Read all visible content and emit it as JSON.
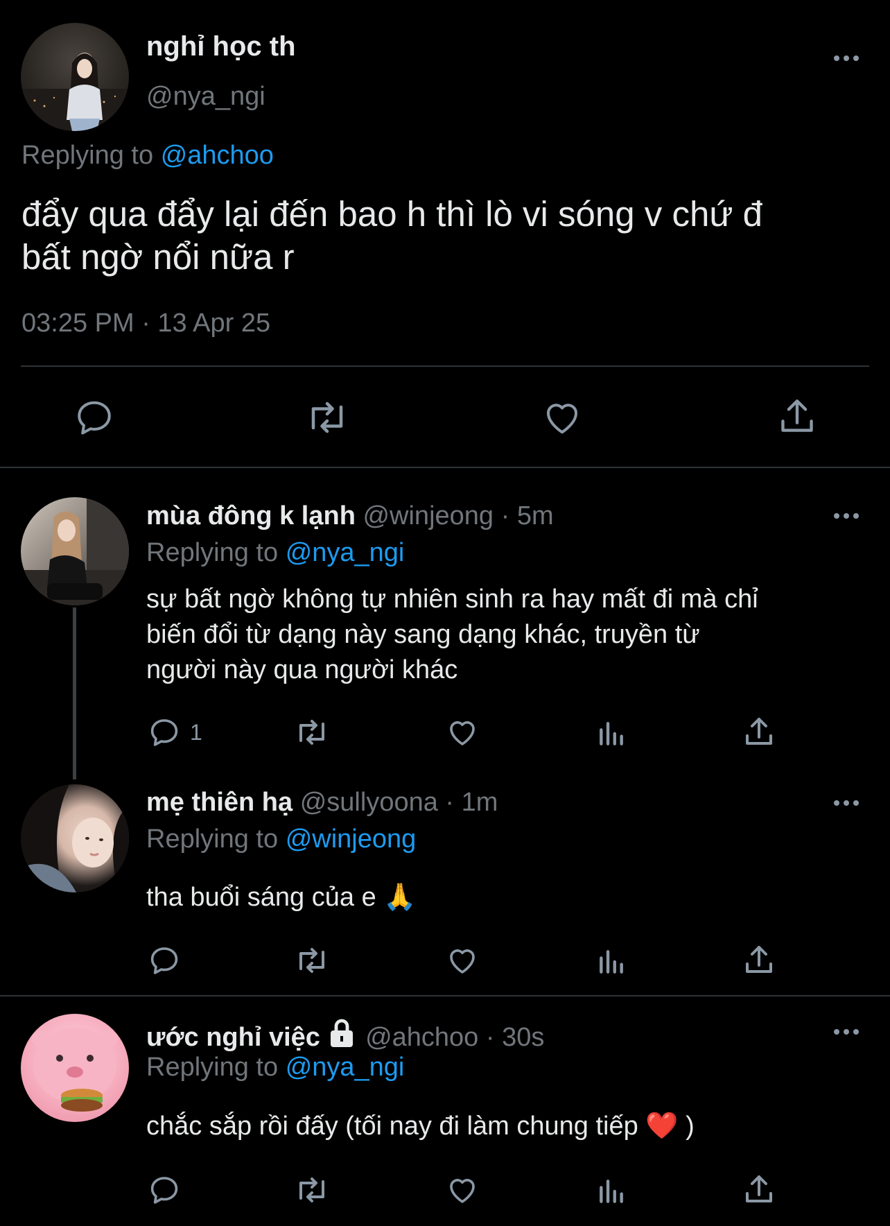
{
  "main_tweet": {
    "display_name": "nghỉ học th",
    "handle": "@nya_ngi",
    "replying_label": "Replying to",
    "replying_to": "@ahchoo",
    "text_line1": "đẩy qua đẩy lại đến bao h thì lò vi sóng v chứ đ",
    "text_line2": "bất ngờ nổi nữa r",
    "timestamp": "03:25 PM · 13 Apr 25"
  },
  "replies": [
    {
      "display_name": "mùa đông k lạnh",
      "handle": "@winjeong",
      "time": "· 5m",
      "replying_label": "Replying to",
      "replying_to": "@nya_ngi",
      "text_lines": [
        "sự bất ngờ không tự nhiên sinh ra hay mất đi mà chỉ",
        "biến đổi từ dạng này sang dạng khác, truyền từ",
        "người này qua người khác"
      ],
      "reply_count": "1"
    },
    {
      "display_name": "mẹ thiên hạ",
      "handle": "@sullyoona",
      "time": "· 1m",
      "replying_label": "Replying to",
      "replying_to": "@winjeong",
      "text": "tha buổi sáng của e 🙏"
    },
    {
      "display_name": "ước nghỉ việc",
      "handle": "@ahchoo",
      "time": "· 30s",
      "replying_label": "Replying to",
      "replying_to": "@nya_ngi",
      "text": "chắc sắp rồi đấy (tối nay đi làm chung tiếp ❤️ )"
    }
  ],
  "colors": {
    "background": "#000000",
    "text": "#e7e9ea",
    "muted": "#71767b",
    "link": "#1d9bf0",
    "heart_emoji": "#e0245e"
  },
  "icons": [
    "reply-icon",
    "retweet-icon",
    "like-icon",
    "share-icon",
    "views-icon",
    "more-icon",
    "lock-icon"
  ]
}
